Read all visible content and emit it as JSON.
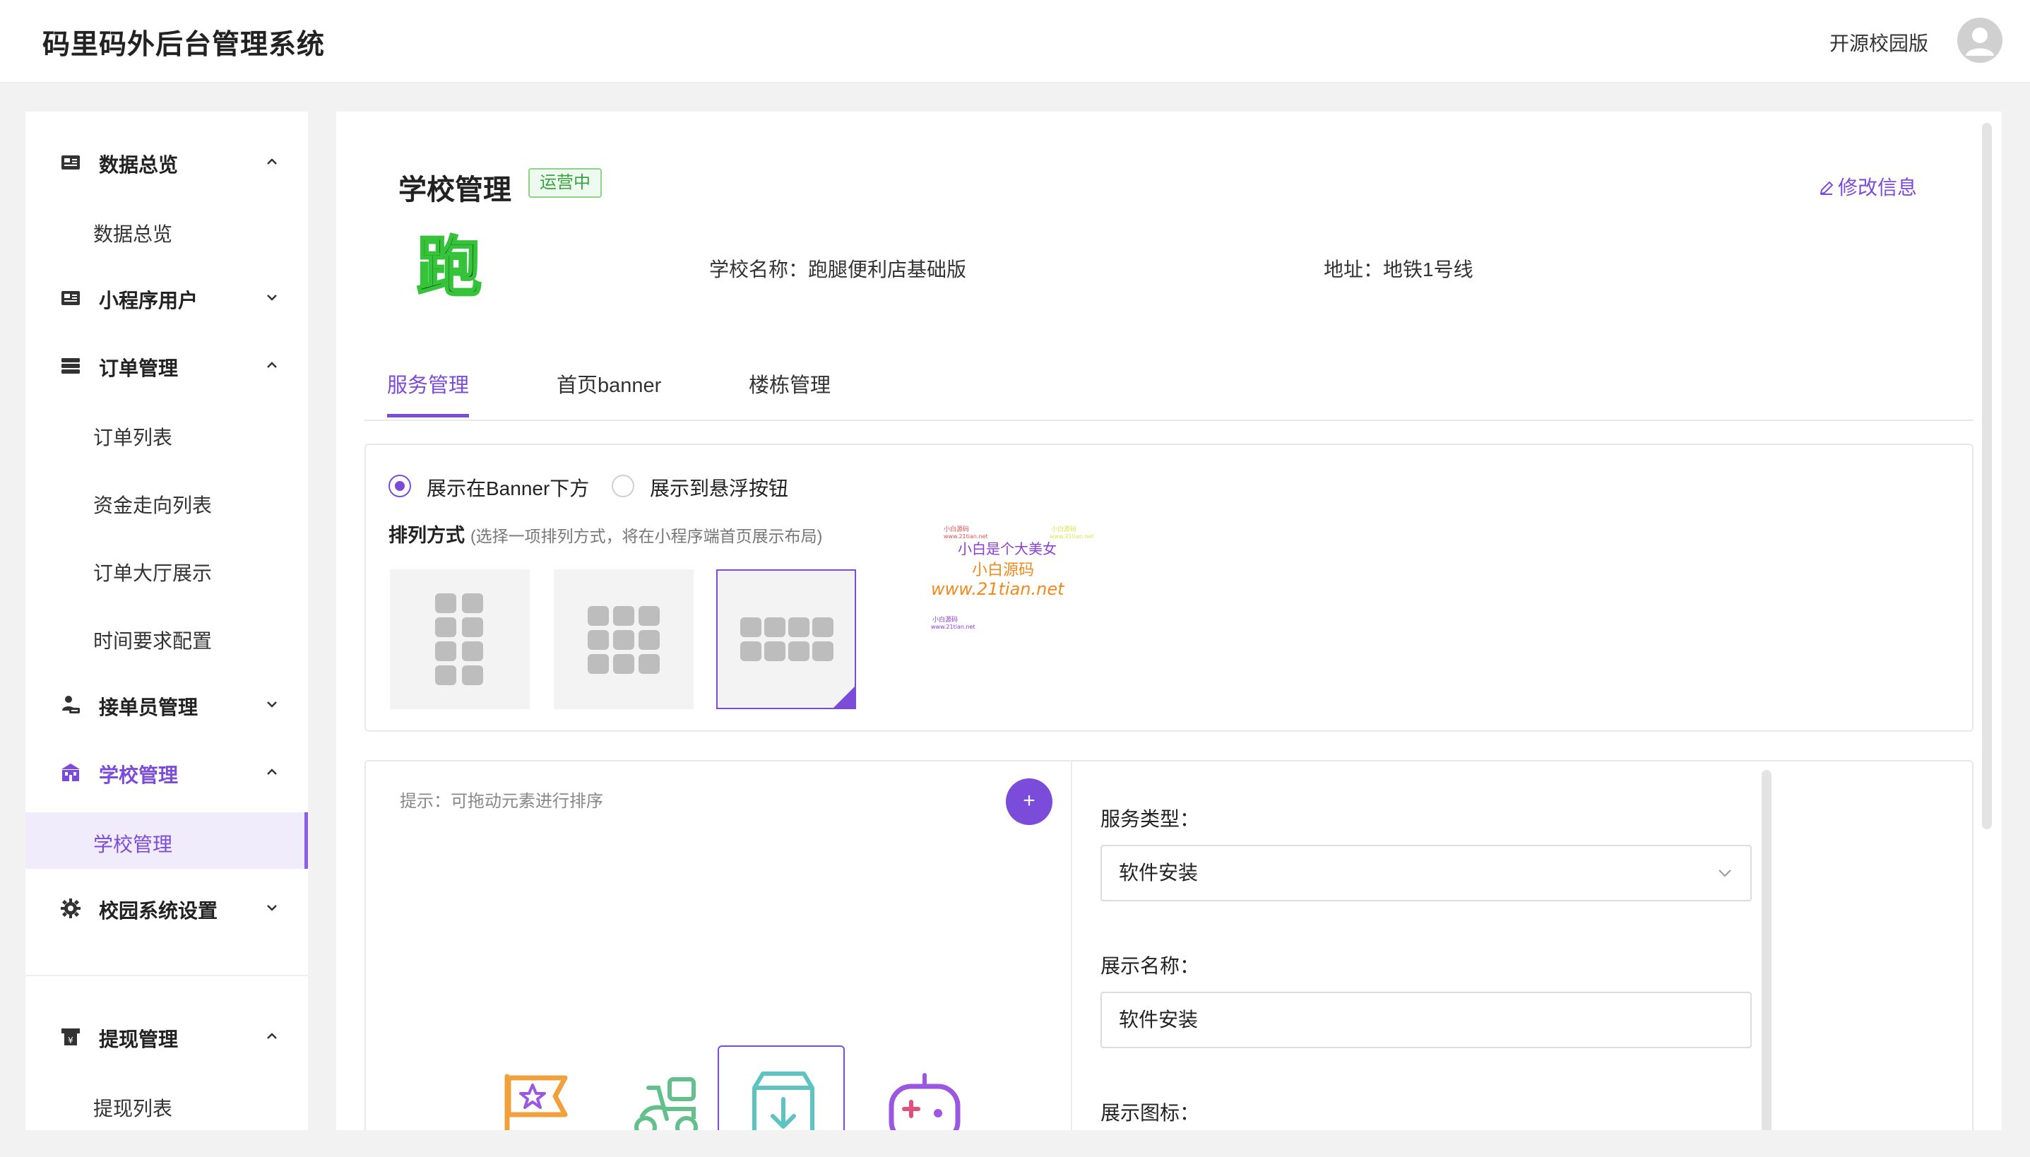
{
  "header": {
    "app_title": "码里码外后台管理系统",
    "edition": "开源校园版"
  },
  "sidebar": {
    "groups": [
      {
        "label": "数据总览",
        "icon": "dashboard-icon",
        "expanded": true,
        "items": [
          "数据总览"
        ]
      },
      {
        "label": "小程序用户",
        "icon": "users-icon",
        "expanded": false,
        "items": []
      },
      {
        "label": "订单管理",
        "icon": "orders-icon",
        "expanded": true,
        "items": [
          "订单列表",
          "资金走向列表",
          "订单大厅展示",
          "时间要求配置"
        ]
      },
      {
        "label": "接单员管理",
        "icon": "courier-icon",
        "expanded": false,
        "items": []
      },
      {
        "label": "学校管理",
        "icon": "school-icon",
        "expanded": true,
        "items": [
          "学校管理"
        ]
      },
      {
        "label": "校园系统设置",
        "icon": "gear-icon",
        "expanded": false,
        "items": []
      },
      {
        "label": "提现管理",
        "icon": "withdraw-icon",
        "expanded": true,
        "items": [
          "提现列表"
        ]
      }
    ],
    "active_item": "学校管理"
  },
  "school": {
    "title": "学校管理",
    "status": "运营中",
    "edit_label": "修改信息",
    "logo_char": "跑",
    "name_label": "学校名称：",
    "name": "跑腿便利店基础版",
    "address_label": "地址：",
    "address": "地铁1号线"
  },
  "tabs": [
    "服务管理",
    "首页banner",
    "楼栋管理"
  ],
  "active_tab": "服务管理",
  "display": {
    "options": [
      "展示在Banner下方",
      "展示到悬浮按钮"
    ],
    "selected": "展示在Banner下方",
    "layout_title": "排列方式",
    "layout_hint": "(选择一项排列方式，将在小程序端首页展示布局)",
    "layout_options": [
      2,
      3,
      4
    ],
    "layout_selected": 4,
    "watermark_lines": [
      "小白源码",
      "www.21tian.net",
      "小白是个大美女",
      "小白源码",
      "www.21tian.net",
      "小白源码",
      "www.21tian.net",
      "小白源码",
      "www.21tian.net"
    ]
  },
  "services": {
    "tip": "提示：可拖动元素进行排序",
    "add_label": "+",
    "icons": [
      "flag-star-icon",
      "scooter-icon",
      "download-box-icon",
      "gamepad-icon"
    ],
    "selected_index": 2
  },
  "form": {
    "type_label": "服务类型：",
    "type_value": "软件安装",
    "name_label": "展示名称：",
    "name_value": "软件安装",
    "icon_label": "展示图标："
  },
  "colors": {
    "accent": "#7b4cd9",
    "running_green": "#3aa33f"
  }
}
